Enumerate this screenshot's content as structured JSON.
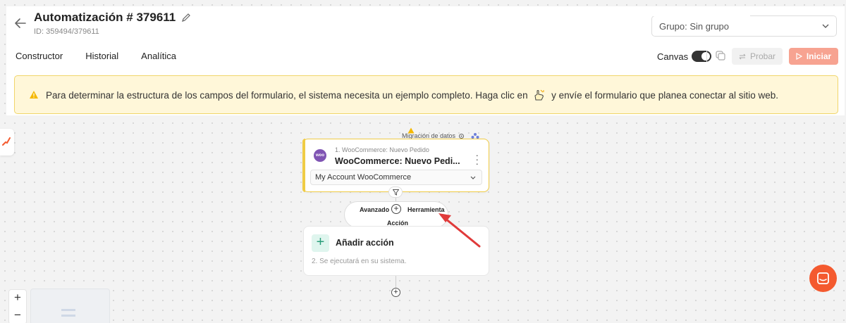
{
  "header": {
    "title": "Automatización # 379611",
    "id_text": "ID: 359494/379611",
    "group_select": "Grupo: Sin grupo"
  },
  "tabs": [
    {
      "label": "Constructor"
    },
    {
      "label": "Historial"
    },
    {
      "label": "Analítica"
    }
  ],
  "toolbar": {
    "canvas_label": "Canvas",
    "canvas_enabled": true,
    "probar_label": "Probar",
    "iniciar_label": "Iniciar"
  },
  "alert": {
    "text_before": "Para determinar la estructura de los campos del formulario, el sistema necesita un ejemplo completo. Haga clic en",
    "text_after": "y envíe el formulario que planea conectar al sitio web."
  },
  "trigger": {
    "badge_label": "Migración de datos",
    "step_label": "1. WooCommerce: Nuevo Pedido",
    "title": "WooCommerce: Nuevo Pedi...",
    "account": "My Account WooCommerce",
    "logo_text": "woo"
  },
  "add_menu": {
    "advanced": "Avanzado",
    "tool": "Herramienta",
    "action": "Acción"
  },
  "action_card": {
    "title": "Añadir acción",
    "hint": "2. Se ejecutará en su sistema."
  },
  "zoom": {
    "in": "+",
    "out": "−"
  },
  "colors": {
    "accent": "#f45a2f",
    "iniciar_bg": "#f7a391",
    "alert_bg": "#fff7d9",
    "trigger_border": "#f0cc45",
    "woo": "#7f54b3",
    "action_plus_bg": "#dff5ee",
    "annotation_arrow": "#e03a3a"
  },
  "icons": [
    "back-arrow-icon",
    "pencil-icon",
    "chevron-down-icon",
    "copy-icon",
    "transfer-icon",
    "play-icon",
    "warning-icon",
    "hand-click-icon",
    "filter-icon",
    "users-icon",
    "gear-icon",
    "chat-icon"
  ]
}
